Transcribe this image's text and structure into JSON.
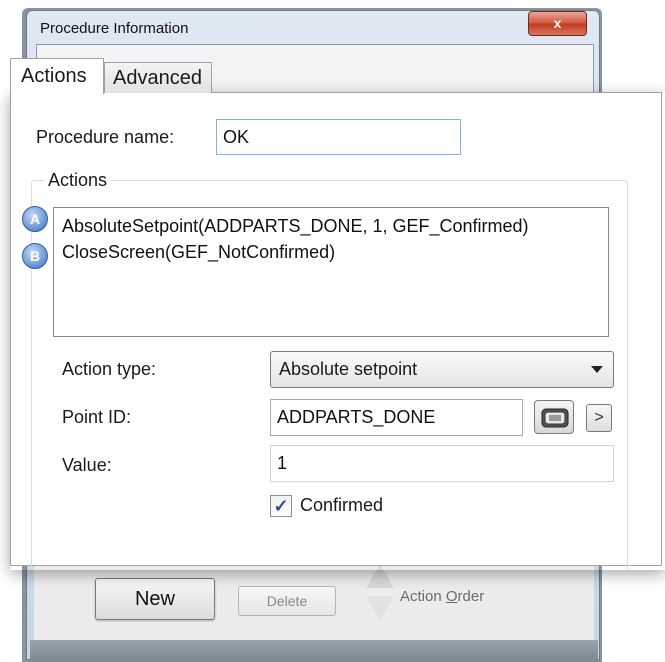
{
  "window": {
    "title": "Procedure Information",
    "close_label": "x"
  },
  "tabs": [
    {
      "label": "Actions",
      "selected": true
    },
    {
      "label": "Advanced",
      "selected": false
    }
  ],
  "form": {
    "procedure_name_label": "Procedure name:",
    "procedure_name_value": "OK",
    "actions_group_label": "Actions",
    "actions_list": [
      {
        "badge": "A",
        "text": "AbsoluteSetpoint(ADDPARTS_DONE, 1, GEF_Confirmed)"
      },
      {
        "badge": "B",
        "text": "CloseScreen(GEF_NotConfirmed)"
      }
    ],
    "action_type_label": "Action type:",
    "action_type_value": "Absolute setpoint",
    "point_id_label": "Point ID:",
    "point_id_value": "ADDPARTS_DONE",
    "point_arrow_label": ">",
    "value_label": "Value:",
    "value_value": "1",
    "confirmed_label": "Confirmed",
    "confirmed_checked": true,
    "check_glyph": "✓"
  },
  "bottom_bar": {
    "new_label": "New",
    "delete_label": "Delete",
    "action_order_prefix": "Action ",
    "action_order_underlined": "O",
    "action_order_suffix": "rder"
  },
  "colors": {
    "badge": "#5f8fd6",
    "close_button": "#c0391f",
    "focus_border": "#7eb4ea"
  }
}
